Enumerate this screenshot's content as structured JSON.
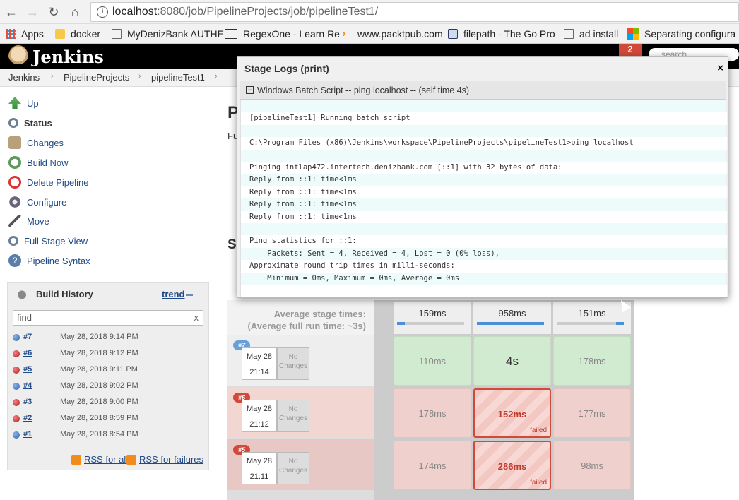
{
  "browser": {
    "url_host": "localhost",
    "url_path": ":8080/job/PipelineProjects/job/pipelineTest1/",
    "bookmarks": [
      "Apps",
      "docker",
      "MyDenizBank AUTHE",
      "RegexOne - Learn Re",
      "www.packtpub.com",
      "filepath - The Go Pro",
      "ad install",
      "Separating configura"
    ]
  },
  "jenkins": {
    "title": "Jenkins",
    "notif": "2",
    "search_placeholder": "search"
  },
  "breadcrumb": [
    "Jenkins",
    "PipelineProjects",
    "pipelineTest1"
  ],
  "sidebar": {
    "tasks": [
      "Up",
      "Status",
      "Changes",
      "Build Now",
      "Delete Pipeline",
      "Configure",
      "Move",
      "Full Stage View",
      "Pipeline Syntax"
    ]
  },
  "page": {
    "title_fragment": "P",
    "desc_fragment": "Fu",
    "section_fragment": "S"
  },
  "build_history": {
    "title": "Build History",
    "trend": "trend",
    "find_value": "find",
    "find_clear": "x",
    "builds": [
      {
        "num": "#7",
        "date": "May 28, 2018 9:14 PM",
        "status": "success"
      },
      {
        "num": "#6",
        "date": "May 28, 2018 9:12 PM",
        "status": "failed"
      },
      {
        "num": "#5",
        "date": "May 28, 2018 9:11 PM",
        "status": "failed"
      },
      {
        "num": "#4",
        "date": "May 28, 2018 9:02 PM",
        "status": "success"
      },
      {
        "num": "#3",
        "date": "May 28, 2018 9:00 PM",
        "status": "failed"
      },
      {
        "num": "#2",
        "date": "May 28, 2018 8:59 PM",
        "status": "failed"
      },
      {
        "num": "#1",
        "date": "May 28, 2018 8:54 PM",
        "status": "success"
      }
    ],
    "rss_all": "RSS for all",
    "rss_failures": "RSS for failures"
  },
  "stage_view": {
    "avg_label_line1": "Average stage times:",
    "avg_label_line2": "(Average full run time: ~3s)",
    "stage_times": [
      "159ms",
      "958ms",
      "151ms"
    ],
    "runs": [
      {
        "badge": "#7",
        "date": "May 28",
        "time": "21:14",
        "no_changes": "No Changes",
        "cells": [
          "110ms",
          "4s",
          "178ms"
        ]
      },
      {
        "badge": "#6",
        "date": "May 28",
        "time": "21:12",
        "no_changes": "No Changes",
        "cells": [
          "178ms",
          "152ms",
          "177ms"
        ],
        "failed_tag": "failed"
      },
      {
        "badge": "#5",
        "date": "May 28",
        "time": "21:11",
        "no_changes": "No Changes",
        "cells": [
          "174ms",
          "286ms",
          "98ms"
        ],
        "failed_tag": "failed"
      }
    ]
  },
  "modal": {
    "title": "Stage Logs (print)",
    "close": "×",
    "step_toggle": "−",
    "step": "Windows Batch Script -- ping localhost -- (self time 4s)",
    "log": [
      "",
      "[pipelineTest1] Running batch script",
      "",
      "C:\\Program Files (x86)\\Jenkins\\workspace\\PipelineProjects\\pipelineTest1>ping localhost",
      "",
      "Pinging intlap472.intertech.denizbank.com [::1] with 32 bytes of data:",
      "Reply from ::1: time<1ms",
      "Reply from ::1: time<1ms",
      "Reply from ::1: time<1ms",
      "Reply from ::1: time<1ms",
      "",
      "Ping statistics for ::1:",
      "    Packets: Sent = 4, Received = 4, Lost = 0 (0% loss),",
      "Approximate round trip times in milli-seconds:",
      "    Minimum = 0ms, Maximum = 0ms, Average = 0ms",
      ""
    ]
  }
}
